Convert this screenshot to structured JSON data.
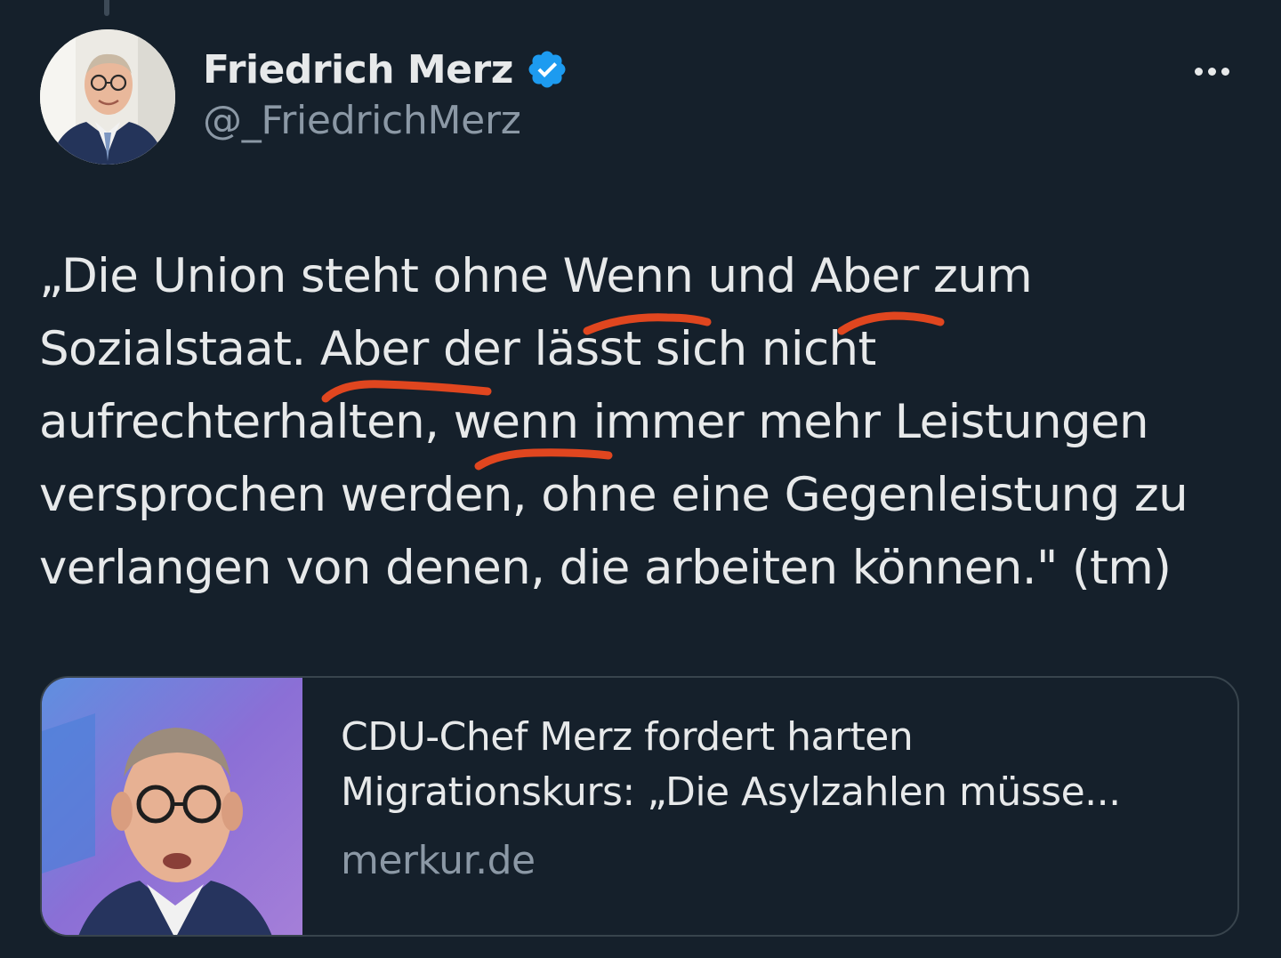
{
  "author": {
    "display_name": "Friedrich Merz",
    "handle": "@_FriedrichMerz",
    "verified": true,
    "verified_badge_color": "#1d9bf0",
    "avatar_icon": "profile-photo"
  },
  "more_icon": "more-horizontal-icon",
  "tweet": {
    "lines": [
      "„Die Union steht ohne Wenn und Aber zum",
      "Sozialstaat. Aber der lässt sich nicht",
      "aufrechterhalten, wenn immer mehr Leistungen",
      "versprochen werden, ohne eine Gegenleistung zu",
      "verlangen von denen, die arbeiten können.\" (tm)"
    ],
    "underline_color": "#e0461f"
  },
  "link_card": {
    "title_lines": [
      "CDU-Chef Merz fordert harten",
      "Migrationskurs: „Die Asylzahlen müsse..."
    ],
    "domain": "merkur.de",
    "thumbnail_icon": "article-photo"
  },
  "colors": {
    "background": "#15202b",
    "text_primary": "#e7e9ea",
    "text_secondary": "#8b98a5",
    "card_border": "#38444d"
  }
}
